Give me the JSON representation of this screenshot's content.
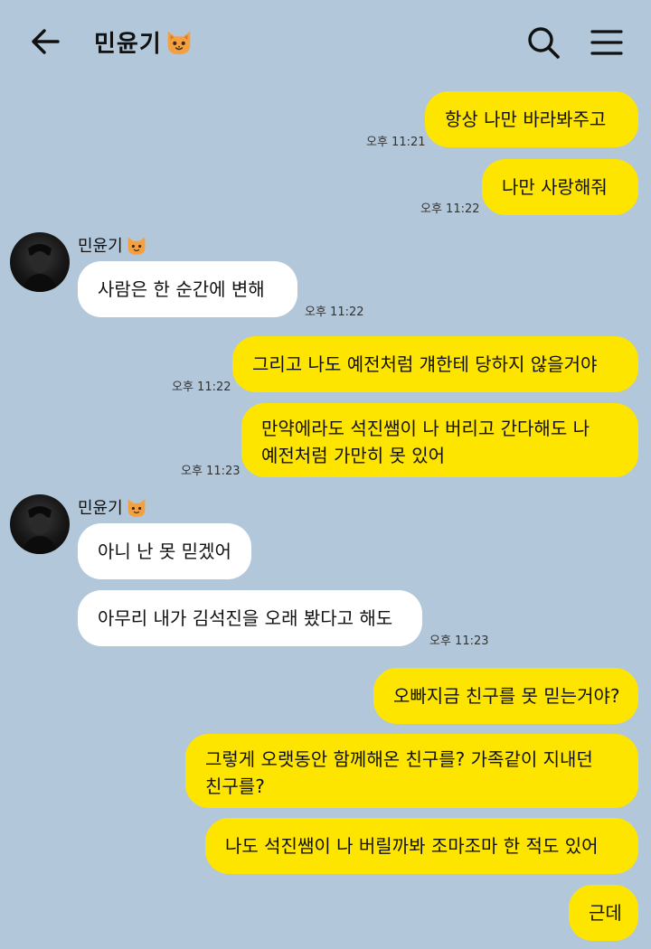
{
  "header": {
    "title": "민윤기"
  },
  "messages": {
    "m1": {
      "text": "항상 나만 바라봐주고",
      "time": "오후 11:21"
    },
    "m2": {
      "text": "나만 사랑해줘",
      "time": "오후 11:22"
    },
    "m3": {
      "sender": "민윤기",
      "text": "사람은 한 순간에 변해",
      "time": "오후 11:22"
    },
    "m4": {
      "text": "그리고 나도 예전처럼 걔한테 당하지 않을거야",
      "time": "오후 11:22"
    },
    "m5": {
      "line1": "만약에라도 석진쌤이 나 버리고 간다해도 나",
      "line2": "예전처럼 가만히 못 있어",
      "time": "오후 11:23"
    },
    "m6": {
      "sender": "민윤기",
      "text": "아니 난 못 믿겠어"
    },
    "m7": {
      "text": "아무리 내가 김석진을 오래 봤다고 해도",
      "time": "오후 11:23"
    },
    "m8": {
      "text": "오빠지금 친구를 못 믿는거야?"
    },
    "m9": {
      "line1": "그렇게 오랫동안 함께해온 친구를? 가족같이 지내던",
      "line2": "친구를?"
    },
    "m10": {
      "text": "나도 석진쌤이 나 버릴까봐 조마조마 한 적도 있어"
    },
    "m11": {
      "text": "근데"
    }
  },
  "colors": {
    "background": "#b2c7d9",
    "my_bubble": "#fee500",
    "other_bubble": "#ffffff"
  }
}
